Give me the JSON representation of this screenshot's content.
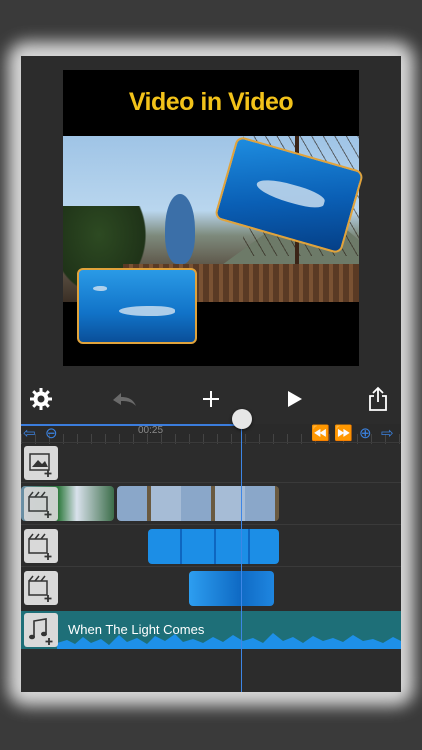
{
  "preview": {
    "title": "Video in Video"
  },
  "toolbar": {
    "settings_icon": "gear-icon",
    "undo_icon": "undo-icon",
    "add_icon": "plus-icon",
    "play_icon": "play-icon",
    "share_icon": "share-icon"
  },
  "timeline": {
    "time_marker": "00:25"
  },
  "tracks": {
    "audio_title": "When The Light Comes"
  },
  "colors": {
    "accent": "#3b82e0",
    "title_yellow": "#f2c21a",
    "audio_track": "#1e6f78"
  }
}
